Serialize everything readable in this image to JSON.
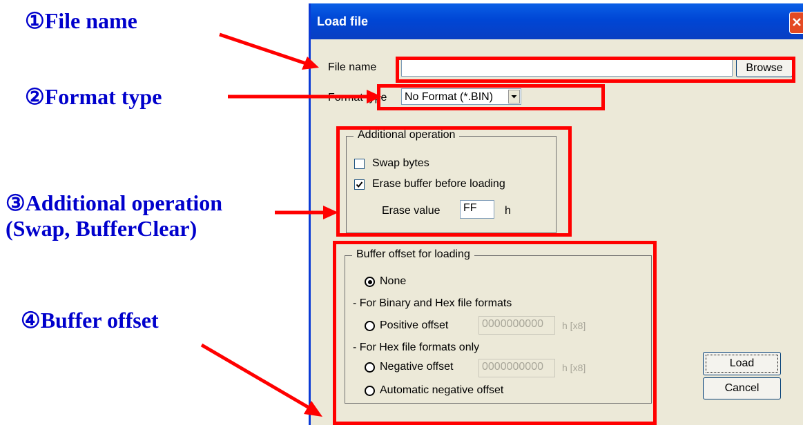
{
  "callouts": {
    "file_name": "①File name",
    "format_type": "②Format type",
    "additional_operation": "③Additional operation",
    "additional_operation_sub": "(Swap, BufferClear)",
    "buffer_offset": "④Buffer offset"
  },
  "dialog": {
    "title": "Load file",
    "close_icon": "close-icon",
    "file_name_label": "File name",
    "file_name_value": "",
    "browse_label": "Browse",
    "format_type_label": "Format type",
    "format_type_selected": "No Format (*.BIN)",
    "additional_group": {
      "title": "Additional operation",
      "swap_bytes_label": "Swap bytes",
      "swap_bytes_checked": false,
      "erase_buffer_label": "Erase buffer before loading",
      "erase_buffer_checked": true,
      "erase_value_label": "Erase value",
      "erase_value": "FF",
      "erase_value_unit": "h"
    },
    "offset_group": {
      "title": "Buffer offset for loading",
      "none_label": "None",
      "binary_hex_heading": "- For Binary and Hex file formats",
      "positive_label": "Positive offset",
      "positive_value": "0000000000",
      "positive_unit": "h [x8]",
      "hex_only_heading": "- For Hex file formats only",
      "negative_label": "Negative offset",
      "negative_value": "0000000000",
      "negative_unit": "h [x8]",
      "automatic_label": "Automatic negative offset",
      "selected": "None"
    },
    "load_label": "Load",
    "cancel_label": "Cancel"
  },
  "colors": {
    "annotation_red": "#ff0000",
    "callout_blue": "#0000cc",
    "title_bar_blue": "#0a5fe6",
    "dialog_face": "#ece9d8"
  }
}
